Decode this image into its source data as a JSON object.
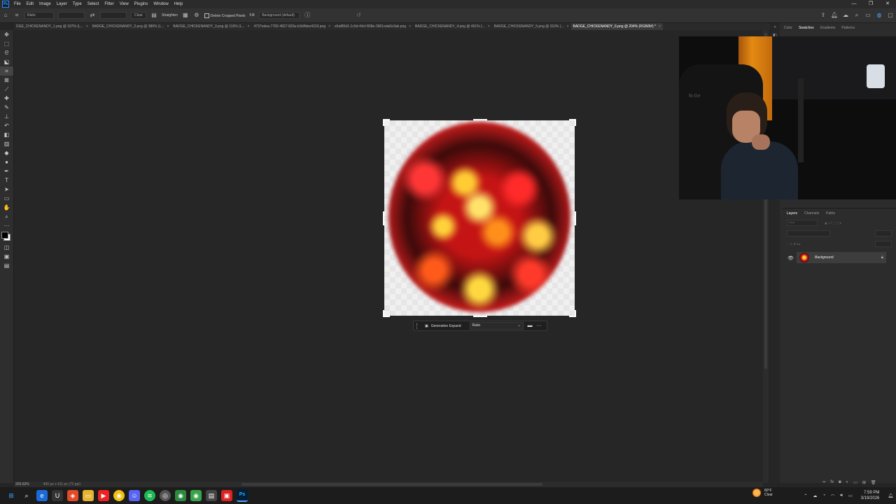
{
  "app": {
    "logo": "Ps",
    "menu": [
      "File",
      "Edit",
      "Image",
      "Layer",
      "Type",
      "Select",
      "Filter",
      "View",
      "Plugins",
      "Window",
      "Help"
    ],
    "window_controls": [
      "—",
      "❐",
      "✕"
    ]
  },
  "options_bar": {
    "ratio_label": "Ratio",
    "clear_label": "Clear",
    "straighten_label": "Straighten",
    "delete_cropped_label": "Delete Cropped Pixels",
    "fill_label": "Fill:",
    "fill_value": "Background (default)"
  },
  "tabs": [
    {
      "label": "DGE_CHICKENANDY_1.png @ 187% (L...",
      "active": false
    },
    {
      "label": "BADGE_CHICKENANDY_2.png @ 386% (L...",
      "active": false
    },
    {
      "label": "BADGE_CHICKENANDY_3.png @ 116% (L...",
      "active": false
    },
    {
      "label": "4737edea-7782-4827-820a-b1bffdee4310.png",
      "active": false
    },
    {
      "label": "e6af85d1-1c5d-44cf-808e-3901eda0e3ab.png",
      "active": false
    },
    {
      "label": "BADGE_CHICKENANDY_4.png @ 461% (...",
      "active": false
    },
    {
      "label": "BADGE_CHICKENANDY_5.png @ 310% (...",
      "active": false
    },
    {
      "label": "BADGE_CHICKENANDY_6.png @ 204% (RGB/8#) *",
      "active": true
    }
  ],
  "contextual_bar": {
    "generative_expand_label": "Generative Expand",
    "ratio_value": "Ratio"
  },
  "top_panel_tabs": [
    "Color",
    "Swatches",
    "Gradients",
    "Patterns"
  ],
  "layers_panel": {
    "tabs": [
      "Layers",
      "Channels",
      "Paths"
    ],
    "search_placeholder": "Kind",
    "layer_name": "Background"
  },
  "webcam": {
    "logo_text": "N-Ge"
  },
  "statusbar": {
    "zoom": "203.52%",
    "doc_size": "400 px x 411 px (72 ppi)"
  },
  "taskbar": {
    "weather_temp": "80°F",
    "weather_desc": "Clear",
    "time": "7:59 PM",
    "date": "3/19/2026"
  }
}
